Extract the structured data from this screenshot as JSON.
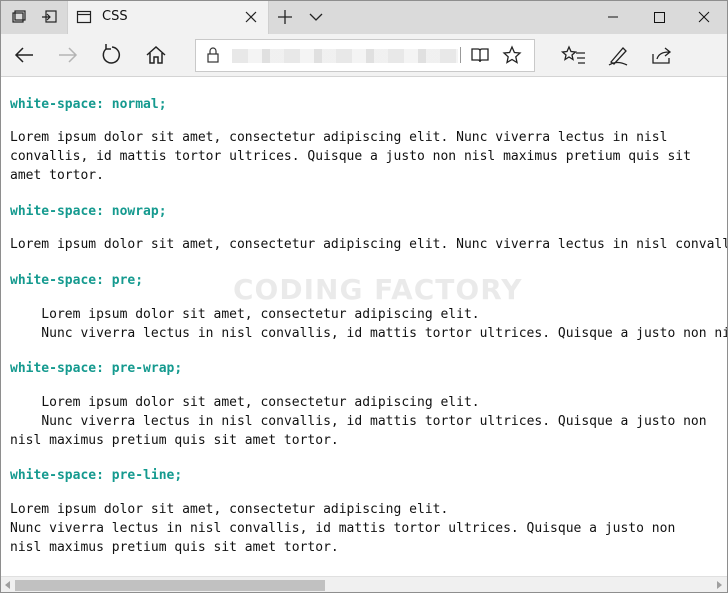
{
  "browser": {
    "tab_title": "CSS",
    "url": "",
    "watermark": "CODING FACTORY"
  },
  "icons": {
    "tab_preview": "tab-preview-icon",
    "set_aside": "set-aside-tabs-icon",
    "page": "page-icon",
    "close_tab": "close-icon",
    "new_tab": "plus-icon",
    "tab_list": "chevron-down-icon",
    "minimize": "minimize-icon",
    "maximize": "maximize-icon",
    "close_window": "close-icon",
    "back": "back-arrow-icon",
    "forward": "forward-arrow-icon",
    "refresh": "refresh-icon",
    "home": "home-icon",
    "lock": "lock-icon",
    "reading_view": "book-icon",
    "favorite": "star-icon",
    "favorites_hub": "favorites-list-icon",
    "notes": "pen-icon",
    "share": "share-icon"
  },
  "sections": [
    {
      "heading": "white-space: normal;",
      "text": "Lorem ipsum dolor sit amet, consectetur adipiscing elit. Nunc viverra lectus in nisl convallis, id mattis tortor ultrices. Quisque a justo non nisl maximus pretium quis sit amet tortor."
    },
    {
      "heading": "white-space: nowrap;",
      "text": "Lorem ipsum dolor sit amet, consectetur adipiscing elit. Nunc viverra lectus in nisl convallis, id mattis tortor ultrices."
    },
    {
      "heading": "white-space: pre;",
      "text": "    Lorem ipsum dolor sit amet, consectetur adipiscing elit.\n    Nunc viverra lectus in nisl convallis, id mattis tortor ultrices. Quisque a justo non nisl"
    },
    {
      "heading": "white-space: pre-wrap;",
      "text": "    Lorem ipsum dolor sit amet, consectetur adipiscing elit.\n    Nunc viverra lectus in nisl convallis, id mattis tortor ultrices. Quisque a justo non nisl maximus pretium quis sit amet tortor."
    },
    {
      "heading": "white-space: pre-line;",
      "text": "Lorem ipsum dolor sit amet, consectetur adipiscing elit.\nNunc viverra lectus in nisl convallis, id mattis tortor ultrices. Quisque a justo non nisl maximus pretium quis sit amet tortor."
    }
  ],
  "colors": {
    "heading": "#159a8f",
    "text": "#111111",
    "titlebar": "#dadada",
    "toolbar": "#f2f2f2"
  }
}
